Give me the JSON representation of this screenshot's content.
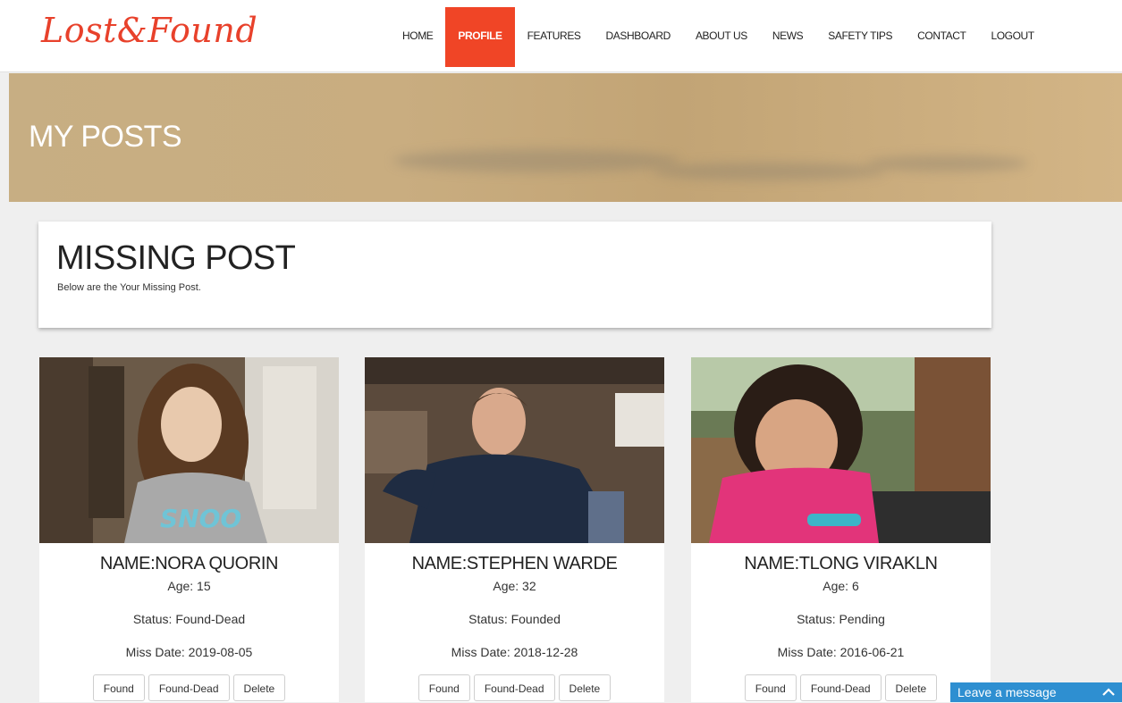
{
  "header": {
    "logo": "Lost&Found",
    "nav": [
      {
        "label": "HOME",
        "active": false
      },
      {
        "label": "PROFILE",
        "active": true
      },
      {
        "label": "FEATURES",
        "active": false
      },
      {
        "label": "DASHBOARD",
        "active": false
      },
      {
        "label": "ABOUT US",
        "active": false
      },
      {
        "label": "NEWS",
        "active": false
      },
      {
        "label": "SAFETY TIPS",
        "active": false
      },
      {
        "label": "CONTACT",
        "active": false
      },
      {
        "label": "LOGOUT",
        "active": false
      }
    ]
  },
  "banner": {
    "title": "MY POSTS"
  },
  "intro": {
    "title": "MISSING POST",
    "subtitle": "Below are the Your Missing Post."
  },
  "cards": [
    {
      "name": "NAME:NORA QUORIN",
      "age": "Age: 15",
      "status": "Status: Found-Dead",
      "miss_date": "Miss Date: 2019-08-05",
      "photo_shirt_text": "SNOO",
      "buttons": {
        "found": "Found",
        "found_dead": "Found-Dead",
        "delete": "Delete"
      }
    },
    {
      "name": "NAME:STEPHEN WARDE",
      "age": "Age: 32",
      "status": "Status: Founded",
      "miss_date": "Miss Date: 2018-12-28",
      "buttons": {
        "found": "Found",
        "found_dead": "Found-Dead",
        "delete": "Delete"
      }
    },
    {
      "name": "NAME:TLONG VIRAKLN",
      "age": "Age: 6",
      "status": "Status: Pending",
      "miss_date": "Miss Date: 2016-06-21",
      "buttons": {
        "found": "Found",
        "found_dead": "Found-Dead",
        "delete": "Delete"
      }
    }
  ],
  "chat": {
    "label": "Leave a message",
    "icon": "chevron-up-icon"
  },
  "colors": {
    "brand": "#e8412b",
    "nav_active": "#f04526",
    "chat": "#2e8fd1",
    "page_bg": "#efefef"
  }
}
